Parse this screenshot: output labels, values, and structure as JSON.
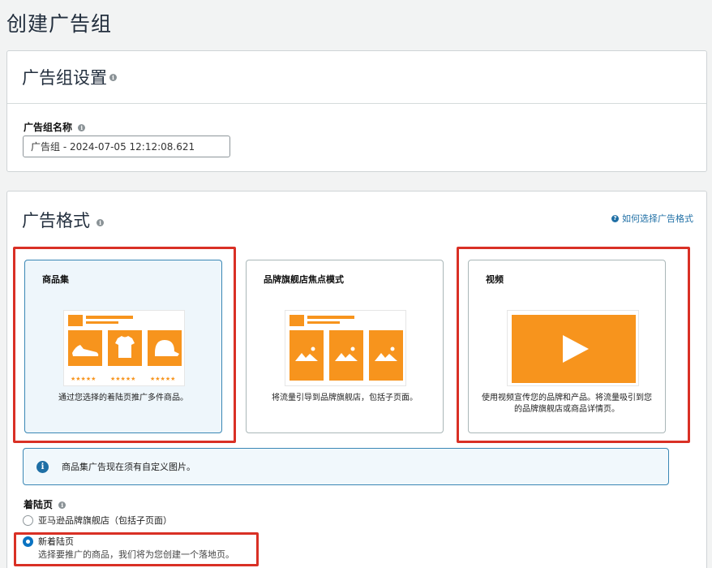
{
  "page": {
    "title": "创建广告组"
  },
  "settings": {
    "title": "广告组设置",
    "name_label": "广告组名称",
    "name_value": "广告组 - 2024-07-05 12:12:08.621"
  },
  "format": {
    "title": "广告格式",
    "help_link": "如何选择广告格式",
    "cards": [
      {
        "title": "商品集",
        "description": "通过您选择的着陆页推广多件商品。",
        "selected": true
      },
      {
        "title": "品牌旗舰店焦点模式",
        "description": "将流量引导到品牌旗舰店，包括子页面。",
        "selected": false
      },
      {
        "title": "视频",
        "description": "使用视频宣传您的品牌和产品。将流量吸引到您的品牌旗舰店或商品详情页。",
        "selected": false
      }
    ],
    "alert": "商品集广告现在须有自定义图片。",
    "landing_label": "着陆页",
    "landing_options": [
      {
        "label": "亚马逊品牌旗舰店（包括子页面）",
        "sub": "",
        "checked": false
      },
      {
        "label": "新着陆页",
        "sub": "选择要推广的商品，我们将为您创建一个落地页。",
        "checked": true
      }
    ]
  },
  "colors": {
    "accent_orange": "#f7941d",
    "highlight_red": "#d93025",
    "link_blue": "#1f6fa5"
  },
  "icons": [
    "info-icon",
    "help-icon",
    "shoe-icon",
    "tshirt-icon",
    "cap-icon",
    "mountain-image-icon",
    "play-icon",
    "star-rating-icon"
  ]
}
